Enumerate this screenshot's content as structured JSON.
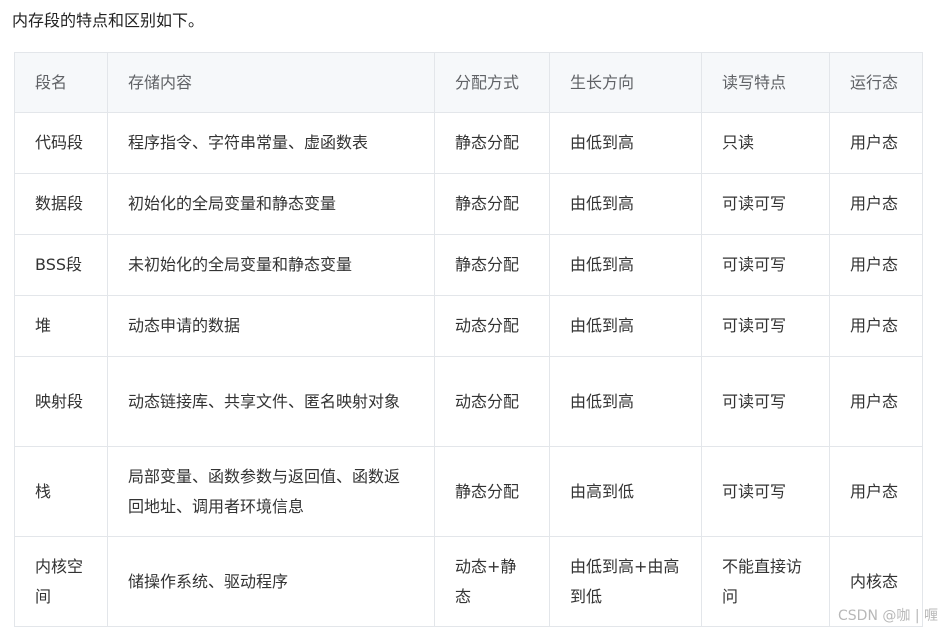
{
  "intro": "内存段的特点和区别如下。",
  "table": {
    "headers": [
      "段名",
      "存储内容",
      "分配方式",
      "生长方向",
      "读写特点",
      "运行态"
    ],
    "rows": [
      [
        "代码段",
        "程序指令、字符串常量、虚函数表",
        "静态分配",
        "由低到高",
        "只读",
        "用户态"
      ],
      [
        "数据段",
        "初始化的全局变量和静态变量",
        "静态分配",
        "由低到高",
        "可读可写",
        "用户态"
      ],
      [
        "BSS段",
        "未初始化的全局变量和静态变量",
        "静态分配",
        "由低到高",
        "可读可写",
        "用户态"
      ],
      [
        "堆",
        "动态申请的数据",
        "动态分配",
        "由低到高",
        "可读可写",
        "用户态"
      ],
      [
        "映射段",
        "动态链接库、共享文件、匿名映射对象",
        "动态分配",
        "由低到高",
        "可读可写",
        "用户态"
      ],
      [
        "栈",
        "局部变量、函数参数与返回值、函数返回地址、调用者环境信息",
        "静态分配",
        "由高到低",
        "可读可写",
        "用户态"
      ],
      [
        "内核空间",
        "储操作系统、驱动程序",
        "动态+静态",
        "由低到高+由高到低",
        "不能直接访问",
        "内核态"
      ]
    ]
  },
  "watermark": "CSDN @咖 | 喱"
}
